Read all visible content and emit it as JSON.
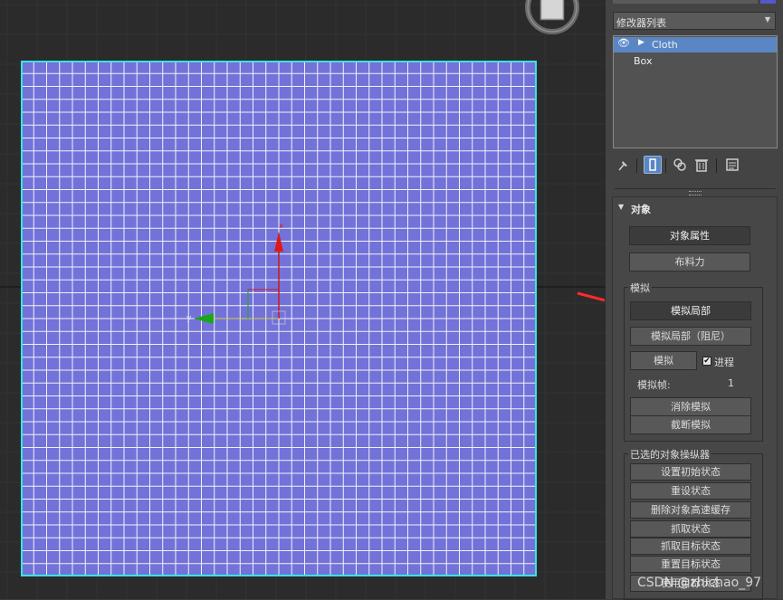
{
  "modifier_list": {
    "label": "修改器列表"
  },
  "stack": {
    "items": [
      "Cloth",
      "Box"
    ]
  },
  "object_rollout": {
    "title": "对象",
    "object_properties_button": "对象属性",
    "cloth_forces_button": "布料力"
  },
  "simulation": {
    "group_title": "模拟",
    "simulate_local_button": "模拟局部",
    "simulate_local_damped_button": "模拟局部（阻尼）",
    "simulate_button": "模拟",
    "progress_checkbox_label": "进程",
    "progress_checked": true,
    "sim_frame_label": "模拟帧:",
    "sim_frame_value": "1",
    "erase_simulation_button": "消除模拟",
    "truncate_simulation_button": "截断模拟"
  },
  "selected_manipulator": {
    "group_title": "已选的对象操纵器",
    "buttons": [
      "设置初始状态",
      "重设状态",
      "删除对象高速缓存",
      "抓取状态",
      "抓取目标状态",
      "重置目标状态",
      "使用目标状态"
    ]
  },
  "watermark": "CSDN @zhichao_97",
  "colors": {
    "plane_fill": "#7272d8",
    "plane_border": "#38e4e4",
    "selection_highlight": "#5a86c4",
    "annotation_arrow": "#ff2a2a"
  }
}
